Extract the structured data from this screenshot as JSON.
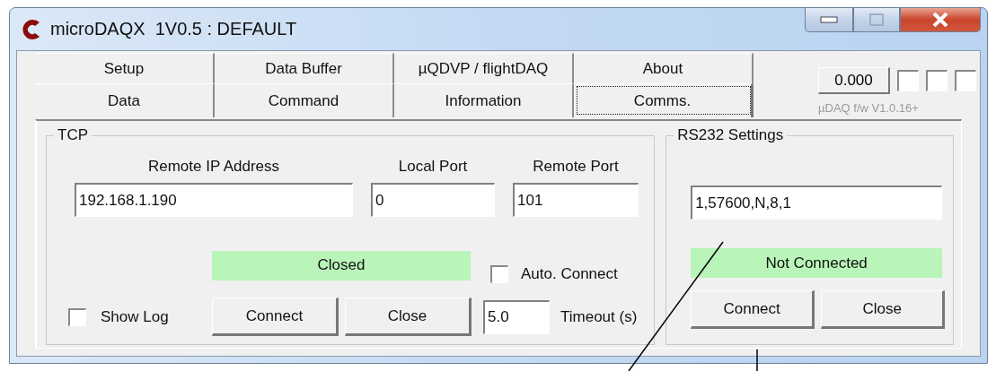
{
  "window": {
    "title": "microDAQX  1V0.5 : DEFAULT"
  },
  "tabs": [
    [
      {
        "label": "Setup",
        "selected": false
      },
      {
        "label": "Data Buffer",
        "selected": false
      },
      {
        "label": "µQDVP / flightDAQ",
        "selected": false
      },
      {
        "label": "About",
        "selected": false
      }
    ],
    [
      {
        "label": "Data",
        "selected": false
      },
      {
        "label": "Command",
        "selected": false
      },
      {
        "label": "Information",
        "selected": false
      },
      {
        "label": "Comms.",
        "selected": true
      }
    ]
  ],
  "readout": {
    "value": "0.000",
    "indicators": [
      {
        "checked": false
      },
      {
        "checked": false
      },
      {
        "checked": false
      }
    ],
    "firmware": "µDAQ f/w V1.0.16+"
  },
  "tcp": {
    "title": "TCP",
    "fields": [
      {
        "label": "Remote IP Address",
        "value": "192.168.1.190"
      },
      {
        "label": "Local Port",
        "value": "0"
      },
      {
        "label": "Remote Port",
        "value": "101"
      }
    ],
    "status": "Closed",
    "auto_connect": {
      "label": "Auto. Connect",
      "checked": false
    },
    "show_log": {
      "label": "Show Log",
      "checked": false
    },
    "buttons": [
      "Connect",
      "Close"
    ],
    "timeout": {
      "value": "5.0",
      "label": "Timeout (s)"
    }
  },
  "rs232": {
    "title": "RS232 Settings",
    "value": "1,57600,N,8,1",
    "status": "Not Connected",
    "buttons": [
      "Connect",
      "Close"
    ]
  }
}
